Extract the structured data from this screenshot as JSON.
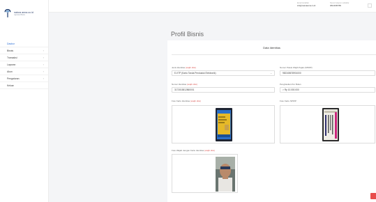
{
  "brand": {
    "name": "natura anna.co.id",
    "tagline": "Laporan Bisnis"
  },
  "sidebar": {
    "items": [
      {
        "label": "Dasbor",
        "active": true,
        "has_chevron": false
      },
      {
        "label": "Bisnis",
        "active": false,
        "has_chevron": true
      },
      {
        "label": "Transaksi",
        "active": false,
        "has_chevron": true
      },
      {
        "label": "Laporan",
        "active": false,
        "has_chevron": true
      },
      {
        "label": "Akun",
        "active": false,
        "has_chevron": true
      },
      {
        "label": "Pengaturan",
        "active": false,
        "has_chevron": true
      },
      {
        "label": "Keluar",
        "active": false,
        "has_chevron": false
      }
    ]
  },
  "topbar": {
    "email_label": "Email terdaftar",
    "email_value": "info@naturaanna.co.id",
    "phone_label": "Nomor telepon terdaftar",
    "phone_value": "08123456789"
  },
  "page": {
    "title": "Profil Bisnis"
  },
  "section": {
    "heading": "Data Identitas"
  },
  "form": {
    "required_mark": "(wajib diisi)",
    "jenis_identitas": {
      "label": "Jenis Identitas",
      "value": "E-KTP (Kartu Tanda Penduduk Elektronik)"
    },
    "nomor_identitas": {
      "label": "Nomor Identitas",
      "value": "3173015812860001"
    },
    "npwp": {
      "label": "Nomor Pokok Wajib Pajak (NPWP)",
      "value": "982345678901000"
    },
    "penghasilan": {
      "label": "Penghasilan Per Bulan",
      "value": "> Rp 10.000.000"
    },
    "foto_identitas": {
      "label": "Foto Kartu Identitas"
    },
    "foto_npwp": {
      "label": "Foto Kartu NPWP"
    },
    "foto_selfie": {
      "label": "Foto Wajah dengan Kartu Identitas"
    }
  },
  "colors": {
    "accent": "#2b6fd6",
    "required": "#d9534f",
    "fab": "#e84c4c"
  }
}
